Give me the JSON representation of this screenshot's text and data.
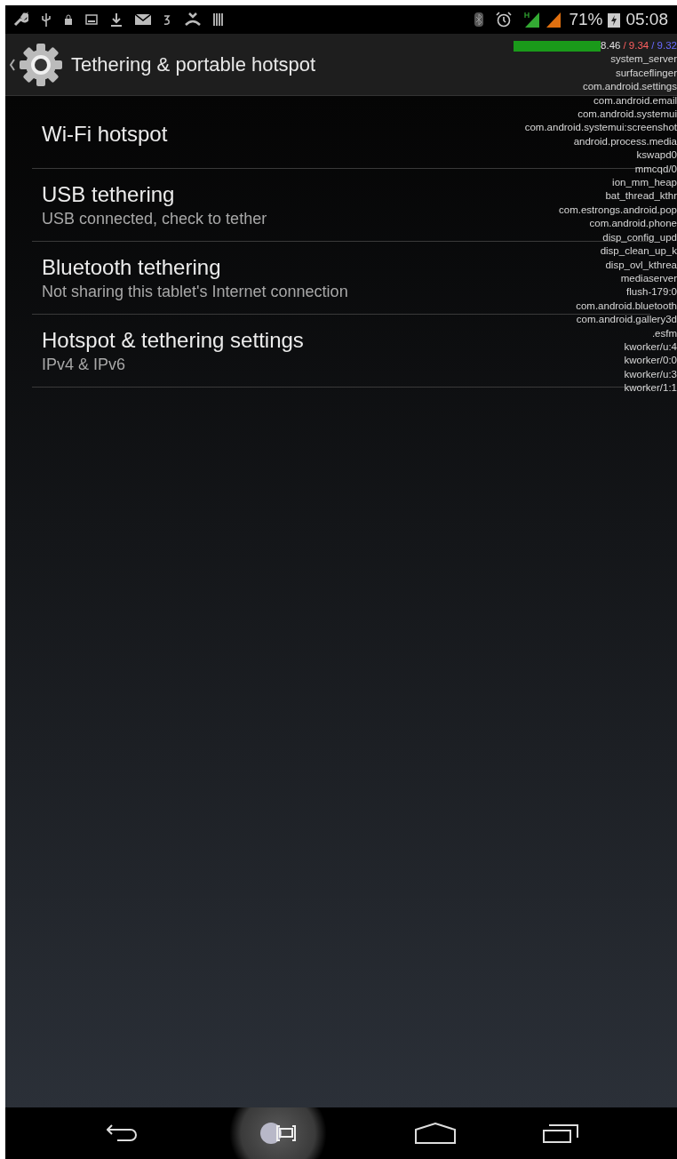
{
  "status_bar": {
    "battery": "71%",
    "time": "05:08"
  },
  "action_bar": {
    "title": "Tethering & portable hotspot"
  },
  "items": [
    {
      "title": "Wi-Fi hotspot"
    },
    {
      "title": "USB tethering",
      "summary": "USB connected, check to tether"
    },
    {
      "title": "Bluetooth tethering",
      "summary": "Not sharing this tablet's Internet connection"
    },
    {
      "title": "Hotspot & tethering settings",
      "summary": "IPv4 & IPv6"
    }
  ],
  "cpu_overlay": {
    "load": [
      {
        "text": "8.46",
        "color": "#e0e0e0"
      },
      {
        "text": "/ 9.34",
        "color": "#ff6060"
      },
      {
        "text": "/ 9.32",
        "color": "#6a6aff"
      }
    ],
    "processes": [
      "system_server",
      "surfaceflinger",
      "com.android.settings",
      "com.android.email",
      "com.android.systemui",
      "com.android.systemui:screenshot",
      "android.process.media",
      "kswapd0",
      "mmcqd/0",
      "ion_mm_heap",
      "bat_thread_kthr",
      "com.estrongs.android.pop",
      "com.android.phone",
      "disp_config_upd",
      "disp_clean_up_k",
      "disp_ovl_kthrea",
      "mediaserver",
      "flush-179:0",
      "com.android.bluetooth",
      "com.android.gallery3d",
      ".esfm",
      "kworker/u:4",
      "kworker/0:0",
      "kworker/u:3",
      "kworker/1:1"
    ]
  }
}
